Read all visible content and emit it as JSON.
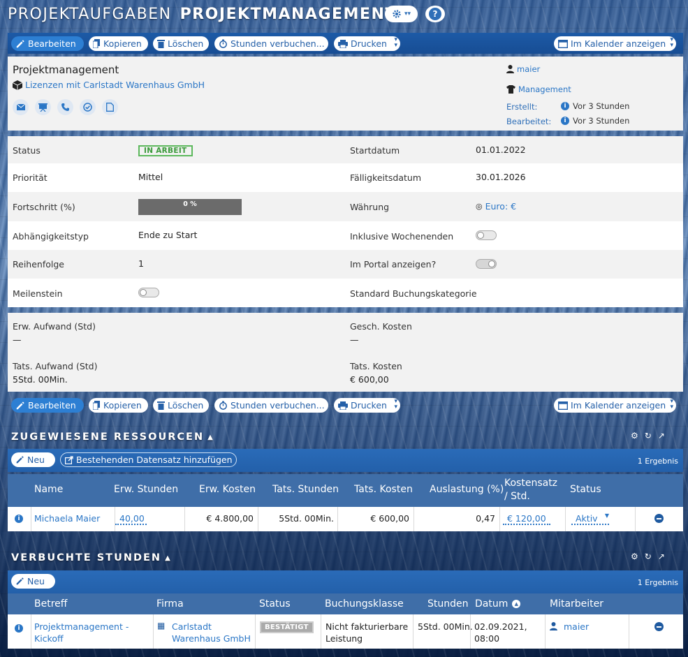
{
  "header": {
    "prefix": "PROJEKTAUFGABEN",
    "title": "PROJEKTMANAGEMENT"
  },
  "toolbar": {
    "edit": "Bearbeiten",
    "copy": "Kopieren",
    "delete": "Löschen",
    "book_hours": "Stunden verbuchen...",
    "print": "Drucken",
    "calendar": "Im Kalender anzeigen"
  },
  "record": {
    "name": "Projektmanagement",
    "account": "Lizenzen mit Carlstadt Warenhaus GmbH",
    "owner": "maier",
    "team": "Management",
    "created_label": "Erstellt:",
    "created_value": "Vor 3 Stunden",
    "edited_label": "Bearbeitet:",
    "edited_value": "Vor 3 Stunden"
  },
  "details": {
    "status_label": "Status",
    "status_value": "IN ARBEIT",
    "priority_label": "Priorität",
    "priority_value": "Mittel",
    "progress_label": "Fortschritt (%)",
    "progress_value": "0 %",
    "progress_fraction": 0,
    "dependency_label": "Abhängigkeitstyp",
    "dependency_value": "Ende zu Start",
    "order_label": "Reihenfolge",
    "order_value": "1",
    "milestone_label": "Meilenstein",
    "milestone_on": false,
    "start_label": "Startdatum",
    "start_value": "01.01.2022",
    "due_label": "Fälligkeitsdatum",
    "due_value": "30.01.2026",
    "currency_label": "Währung",
    "currency_value": "Euro: €",
    "weekends_label": "Inklusive Wochenenden",
    "weekends_on": false,
    "portal_label": "Im Portal anzeigen?",
    "portal_on": true,
    "booking_cat_label": "Standard Buchungskategorie"
  },
  "summary": {
    "est_effort_label": "Erw. Aufwand (Std)",
    "est_effort_value": "—",
    "est_cost_label": "Gesch. Kosten",
    "est_cost_value": "—",
    "act_effort_label": "Tats. Aufwand (Std)",
    "act_effort_value": "5Std. 00Min.",
    "act_cost_label": "Tats. Kosten",
    "act_cost_value": "€ 600,00"
  },
  "resources": {
    "title": "ZUGEWIESENE RESSOURCEN",
    "new_label": "Neu",
    "add_existing_label": "Bestehenden Datensatz hinzufügen",
    "count": "1 Ergebnis",
    "columns": {
      "name": "Name",
      "est_hours": "Erw. Stunden",
      "est_cost": "Erw. Kosten",
      "act_hours": "Tats. Stunden",
      "act_cost": "Tats. Kosten",
      "utilization": "Auslastung (%)",
      "rate_line1": "Kostensatz",
      "rate_line2": "/ Std.",
      "status": "Status"
    },
    "rows": [
      {
        "name": "Michaela Maier",
        "est_hours": "40,00",
        "est_cost": "€ 4.800,00",
        "act_hours": "5Std. 00Min.",
        "act_cost": "€ 600,00",
        "utilization": "0,47",
        "rate": "€ 120,00",
        "status": "Aktiv"
      }
    ]
  },
  "hours": {
    "title": "VERBUCHTE STUNDEN",
    "new_label": "Neu",
    "count": "1 Ergebnis",
    "columns": {
      "subject": "Betreff",
      "company": "Firma",
      "status": "Status",
      "booking_class": "Buchungsklasse",
      "hours": "Stunden",
      "date": "Datum",
      "employee": "Mitarbeiter"
    },
    "rows": [
      {
        "subject_line1": "Projektmanagement -",
        "subject_line2": "Kickoff",
        "company_line1": "Carlstadt",
        "company_line2": "Warenhaus GmbH",
        "status": "BESTÄTIGT",
        "class_line1": "Nicht fakturierbare",
        "class_line2": "Leistung",
        "hours": "5Std. 00Min.",
        "date_line1": "02.09.2021,",
        "date_line2": "08:00",
        "employee": "maier"
      }
    ]
  },
  "colors": {
    "accent": "#2a76c6",
    "status_green": "#5cb85c",
    "table_header": "#3f6ea8"
  }
}
